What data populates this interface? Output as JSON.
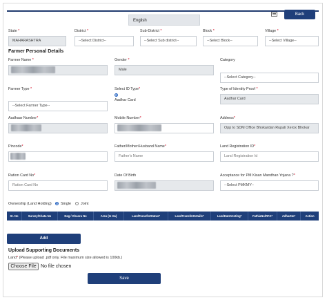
{
  "header": {
    "language": "English",
    "back_label": "Back"
  },
  "location": {
    "state_label": "State",
    "state_value": "MAHARASHTRA",
    "district_label": "District",
    "district_value": "--Select District--",
    "subdistrict_label": "Sub-District",
    "subdistrict_value": "--Select Sub district--",
    "block_label": "Block",
    "block_value": "--Select Block--",
    "village_label": "Village",
    "village_value": "--Select Village--"
  },
  "personal": {
    "section_title": "Farmer Personal Details",
    "farmer_name_label": "Farmer Name",
    "gender_label": "Gender",
    "gender_value": "Male",
    "category_label": "Category",
    "category_value": "--Select Category--",
    "farmer_type_label": "Farmer Type",
    "farmer_type_value": "--Select Farmer Type--",
    "select_id_label": "Select ID Type",
    "aadhar_card_option": "Aadhar Card",
    "identity_proof_label": "Type of Identity Proof",
    "identity_proof_value": "Aadhar Card",
    "aadhaar_number_label": "Aadhaar Number",
    "mobile_label": "Mobile Number",
    "address_label": "Address",
    "address_value": "Opp to SDM Office Bhokardan Rupali Xerox Bhokar",
    "pincode_label": "Pincode",
    "father_label": "Father/Mother/Husband Name",
    "father_placeholder": "Father's Name",
    "land_reg_label": "Land Registration ID",
    "land_reg_placeholder": "Land Registration Id",
    "ration_label": "Ration Card No",
    "ration_placeholder": "Ration Card No",
    "dob_label": "Date Of Birth",
    "pm_label": "Acceptance for PM Kisan Mandhan Yojana ?",
    "pm_value": "--Select PMKMY--",
    "ownership_label": "Ownership (Land Holding)",
    "single_label": "Single",
    "joint_label": "Joint"
  },
  "table": {
    "headers": [
      "Sr. No",
      "Survey/Khata No",
      "Dag / Khasra No",
      "Area (In Ha)",
      "LandTransferStatus*",
      "LandTransferDetails*",
      "LandDateVesting*",
      "FathiaNo/RFA*",
      "AdharNo*",
      "Action"
    ]
  },
  "add_label": "Add",
  "upload": {
    "title": "Upload Supporting Documents",
    "land_label": "Land",
    "hint": "(Please upload .pdf only. File maximum size allowed is 100kb.)",
    "choose_label": "Choose File",
    "no_file": "No file chosen"
  },
  "save_label": "Save",
  "colors": {
    "primary": "#1f3f7a",
    "required": "#d0021b"
  }
}
